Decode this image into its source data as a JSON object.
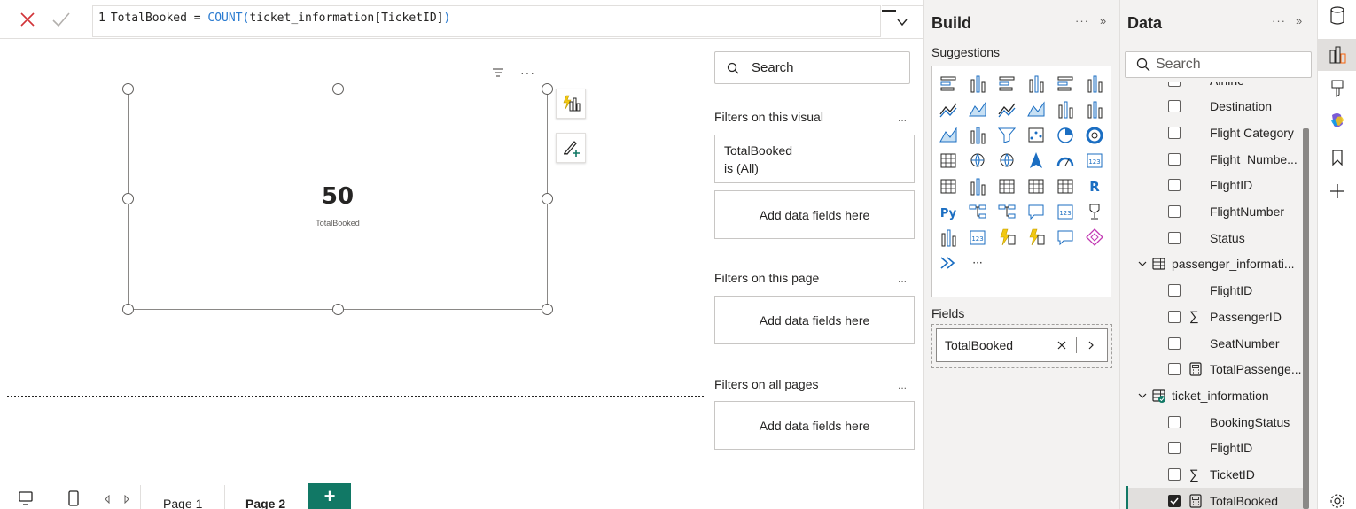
{
  "formula": {
    "line_number": "1",
    "measure_name": "TotalBooked = ",
    "function": "COUNT",
    "open": "(",
    "argument": "ticket_information[TicketID]",
    "close": ")"
  },
  "visual": {
    "value": "50",
    "label": "TotalBooked"
  },
  "page_tabs": {
    "tabs": [
      "Page 1",
      "Page 2"
    ],
    "active": "Page 2",
    "add_label": "+"
  },
  "filters_pane": {
    "search_placeholder": "Search",
    "sections": {
      "visual": {
        "title": "Filters on this visual",
        "card": {
          "field": "TotalBooked",
          "condition": "is (All)"
        },
        "drop_text": "Add data fields here"
      },
      "page": {
        "title": "Filters on this page",
        "drop_text": "Add data fields here"
      },
      "all": {
        "title": "Filters on all pages",
        "drop_text": "Add data fields here"
      }
    },
    "more": "..."
  },
  "build_pane": {
    "title": "Build",
    "more": "···",
    "collapse": "»",
    "suggestions_label": "Suggestions",
    "gallery_more": "···",
    "fields_label": "Fields",
    "field_pill": "TotalBooked"
  },
  "data_pane": {
    "title": "Data",
    "more": "···",
    "collapse": "»",
    "search_placeholder": "Search",
    "items": [
      {
        "label": "Airline",
        "kind": "field",
        "checked": false
      },
      {
        "label": "Destination",
        "kind": "field",
        "checked": false
      },
      {
        "label": "Flight Category",
        "kind": "field",
        "checked": false
      },
      {
        "label": "Flight_Numbe...",
        "kind": "field",
        "checked": false
      },
      {
        "label": "FlightID",
        "kind": "field",
        "checked": false
      },
      {
        "label": "FlightNumber",
        "kind": "field",
        "checked": false
      },
      {
        "label": "Status",
        "kind": "field",
        "checked": false
      },
      {
        "label": "passenger_informati...",
        "kind": "table"
      },
      {
        "label": "FlightID",
        "kind": "field",
        "checked": false
      },
      {
        "label": "PassengerID",
        "kind": "sum",
        "checked": false
      },
      {
        "label": "SeatNumber",
        "kind": "field",
        "checked": false
      },
      {
        "label": "TotalPassenge...",
        "kind": "measure",
        "checked": false
      },
      {
        "label": "ticket_information",
        "kind": "table-used"
      },
      {
        "label": "BookingStatus",
        "kind": "field",
        "checked": false
      },
      {
        "label": "FlightID",
        "kind": "field",
        "checked": false
      },
      {
        "label": "TicketID",
        "kind": "sum",
        "checked": false
      },
      {
        "label": "TotalBooked",
        "kind": "measure",
        "checked": true
      }
    ]
  },
  "colors": {
    "accent": "#117865",
    "dax_function": "#2b7bd0",
    "cancel_x": "#d13438"
  }
}
